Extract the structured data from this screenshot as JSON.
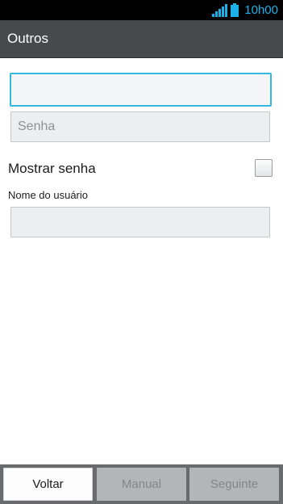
{
  "status_bar": {
    "time": "10h00",
    "signal_icon": "signal-bars-icon",
    "battery_icon": "battery-icon",
    "accent_color": "#1ab2e8"
  },
  "header": {
    "title": "Outros"
  },
  "form": {
    "first_field": {
      "value": "",
      "placeholder": ""
    },
    "password_field": {
      "value": "",
      "placeholder": "Senha"
    },
    "show_password_label": "Mostrar senha",
    "show_password_checked": false,
    "username_label": "Nome do usuário",
    "username_field": {
      "value": "",
      "placeholder": ""
    }
  },
  "footer": {
    "back_label": "Voltar",
    "manual_label": "Manual",
    "next_label": "Seguinte"
  }
}
